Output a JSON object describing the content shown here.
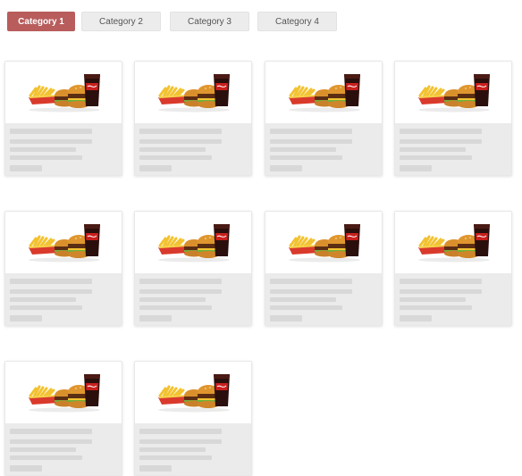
{
  "tabs": [
    {
      "label": "Category 1",
      "active": true
    },
    {
      "label": "Category 2",
      "active": false
    },
    {
      "label": "Category 3",
      "active": false
    },
    {
      "label": "Category 4",
      "active": false
    }
  ],
  "cards": [
    {
      "image": "combo-meal-image",
      "loading": true
    },
    {
      "image": "combo-meal-image",
      "loading": true
    },
    {
      "image": "combo-meal-image",
      "loading": true
    },
    {
      "image": "combo-meal-image",
      "loading": true
    },
    {
      "image": "combo-meal-image",
      "loading": true
    },
    {
      "image": "combo-meal-image",
      "loading": true
    },
    {
      "image": "combo-meal-image",
      "loading": true
    },
    {
      "image": "combo-meal-image",
      "loading": true
    },
    {
      "image": "combo-meal-image",
      "loading": true
    },
    {
      "image": "combo-meal-image",
      "loading": true
    }
  ],
  "colors": {
    "active_tab": "#b85c5c",
    "inactive_tab": "#ececec",
    "skeleton": "#ebebeb"
  }
}
